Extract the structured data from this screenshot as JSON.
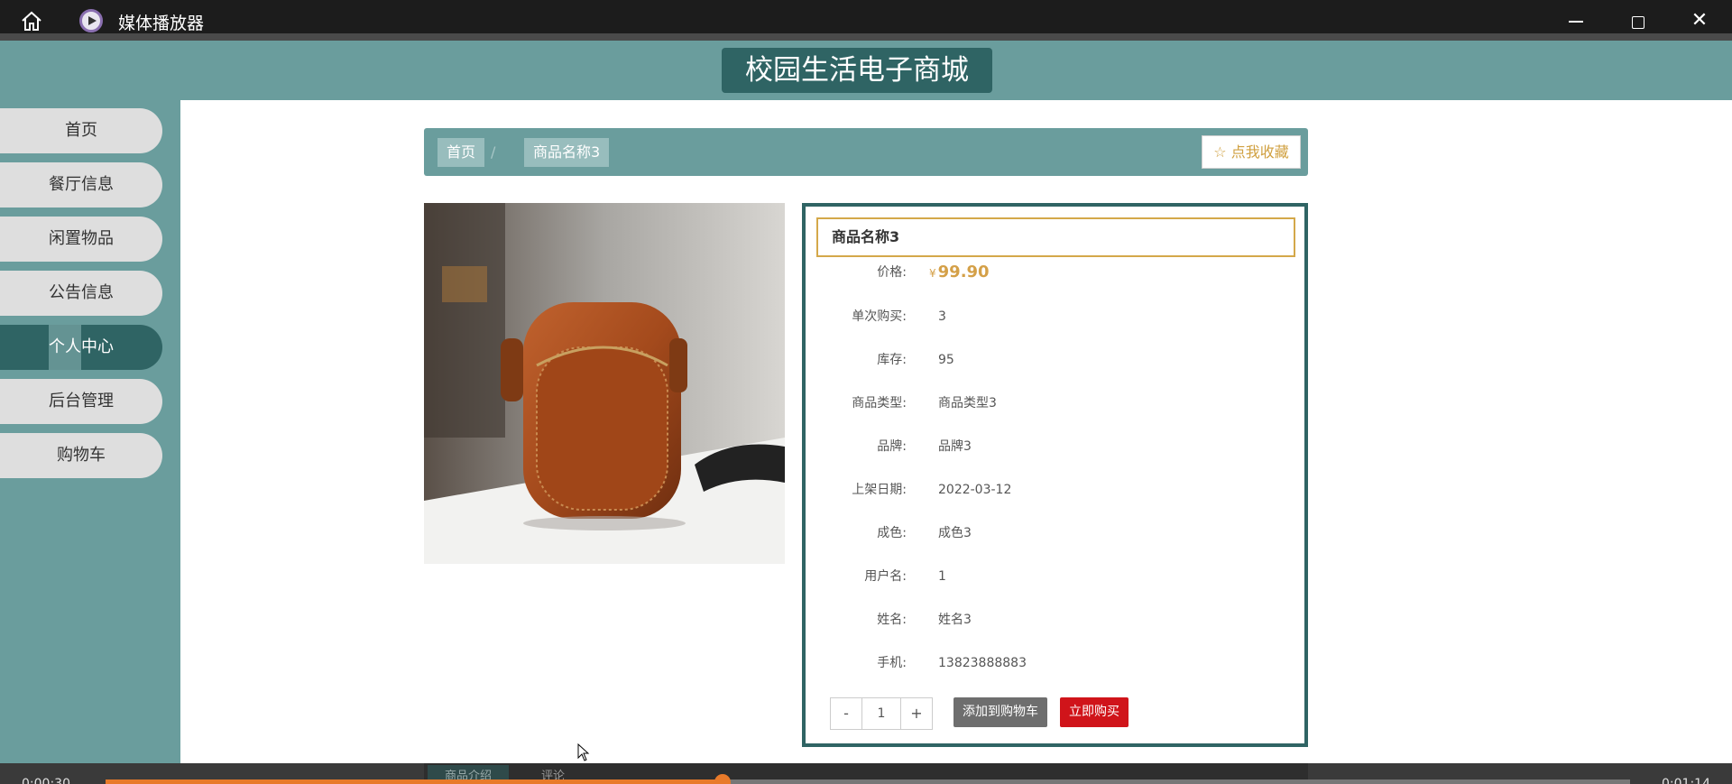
{
  "window": {
    "app_title": "媒体播放器",
    "close_glyph": "✕"
  },
  "header": {
    "site_title": "校园生活电子商城"
  },
  "sidebar": {
    "items": [
      {
        "label": "首页"
      },
      {
        "label": "餐厅信息"
      },
      {
        "label": "闲置物品"
      },
      {
        "label": "公告信息"
      },
      {
        "label": "个人中心",
        "active": true
      },
      {
        "label": "后台管理"
      },
      {
        "label": "购物车"
      }
    ]
  },
  "breadcrumb": {
    "home": "首页",
    "separator": "/",
    "current": "商品名称3",
    "favorite_label": "☆ 点我收藏"
  },
  "product": {
    "name": "商品名称3",
    "price_label": "价格:",
    "currency": "¥",
    "price": "99.90",
    "fields": [
      {
        "label": "单次购买:",
        "value": "3"
      },
      {
        "label": "库存:",
        "value": "95"
      },
      {
        "label": "商品类型:",
        "value": "商品类型3"
      },
      {
        "label": "品牌:",
        "value": "品牌3"
      },
      {
        "label": "上架日期:",
        "value": "2022-03-12"
      },
      {
        "label": "成色:",
        "value": "成色3"
      },
      {
        "label": "用户名:",
        "value": "1"
      },
      {
        "label": "姓名:",
        "value": "姓名3"
      },
      {
        "label": "手机:",
        "value": "13823888883"
      }
    ],
    "quantity": "1",
    "minus": "-",
    "plus": "+",
    "add_to_cart": "添加到购物车",
    "buy_now": "立即购买"
  },
  "tabs": {
    "intro": "商品介绍",
    "comments": "评论"
  },
  "media": {
    "elapsed": "0:00:30",
    "total": "0:01:14",
    "progress": 0.405
  },
  "colors": {
    "teal": "#6a9d9d",
    "dark_teal": "#2f6464",
    "gold": "#d4a84a",
    "buy_red": "#d0141a",
    "progress_orange": "#e87a2a"
  }
}
